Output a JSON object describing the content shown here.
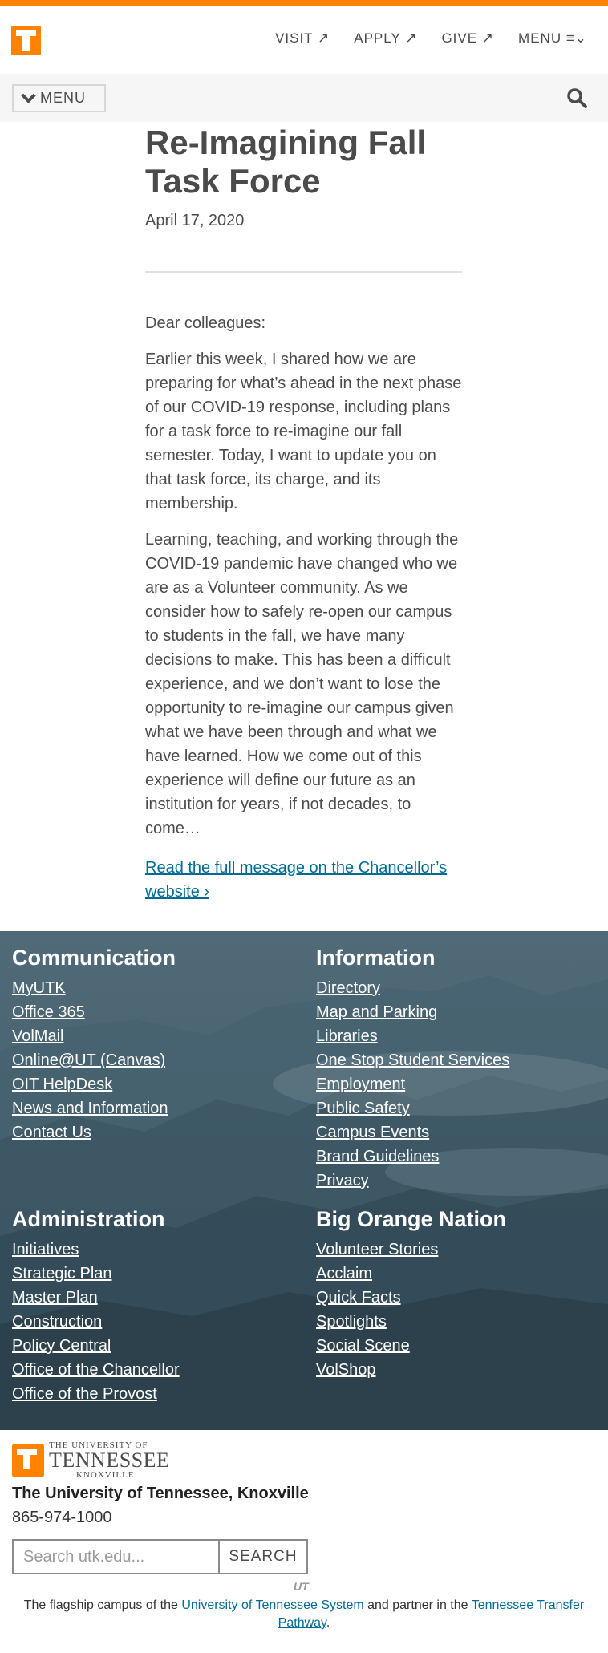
{
  "header": {
    "nav": [
      "VISIT ↗",
      "APPLY ↗",
      "GIVE ↗",
      "MENU ≡⌄"
    ]
  },
  "subbar": {
    "menu_label": "MENU"
  },
  "article": {
    "title": "Re-Imagining Fall Task Force",
    "date": "April 17, 2020",
    "paragraphs": [
      "Dear colleagues:",
      "Earlier this week, I shared how we are preparing for what’s ahead in the next phase of our COVID-19 response, including plans for a task force to re-imagine our fall semester. Today, I want to update you on that task force, its charge, and its membership.",
      "Learning, teaching, and working through the COVID-19 pandemic have changed who we are as a Volunteer community. As we consider how to safely re-open our campus to students in the fall, we have many decisions to make. This has been a difficult experience, and we don’t want to lose the opportunity to re-imagine our campus given what we have been through and what we have learned. How we come out of this experience will define our future as an institution for years, if not decades, to come…"
    ],
    "read_more": "Read the full message on the Chancellor’s website ›"
  },
  "footer_nav": {
    "communication": {
      "heading": "Communication",
      "links": [
        "MyUTK",
        "Office 365",
        "VolMail",
        "Online@UT (Canvas)",
        "OIT HelpDesk",
        "News and Information",
        "Contact Us"
      ]
    },
    "information": {
      "heading": "Information",
      "links": [
        "Directory",
        "Map and Parking",
        "Libraries",
        "One Stop Student Services",
        "Employment",
        "Public Safety",
        "Campus Events",
        "Brand Guidelines",
        "Privacy"
      ]
    },
    "administration": {
      "heading": "Administration",
      "links": [
        "Initiatives",
        "Strategic Plan",
        "Master Plan",
        "Construction",
        "Policy Central",
        "Office of the Chancellor",
        "Office of the Provost"
      ]
    },
    "big_orange_nation": {
      "heading": "Big Orange Nation",
      "links": [
        "Volunteer Stories",
        "Acclaim",
        "Quick Facts",
        "Spotlights",
        "Social Scene",
        "VolShop"
      ]
    }
  },
  "bottom_footer": {
    "logo_top": "THE UNIVERSITY OF",
    "logo_main": "TENNESSEE",
    "logo_bottom": "KNOXVILLE",
    "university_name": "The University of Tennessee, Knoxville",
    "phone": "865-974-1000",
    "search_placeholder": "Search utk.edu...",
    "search_button": "SEARCH",
    "ut_badge": "UT",
    "flagship_prefix": "The flagship campus of the ",
    "flagship_link1": "University of Tennessee System",
    "flagship_middle": " and partner in the ",
    "flagship_link2": "Tennessee Transfer Pathway",
    "flagship_suffix": "."
  },
  "colors": {
    "brand_orange": "#ff8200",
    "link_blue": "#006c93",
    "text_gray": "#4b4b4b",
    "footer_slate": "#4a6371"
  }
}
